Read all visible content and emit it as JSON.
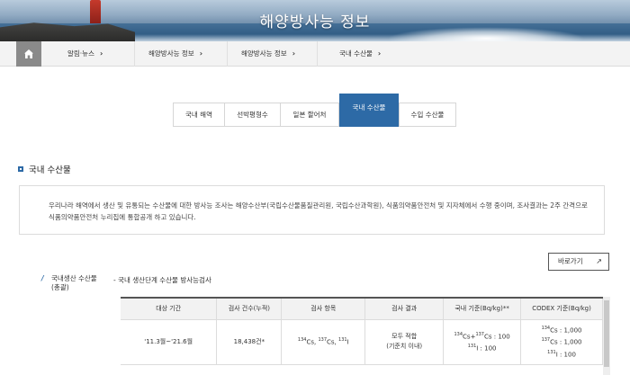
{
  "banner": {
    "title": "해양방사능 정보"
  },
  "breadcrumb": {
    "items": [
      "알림·뉴스",
      "해양방사능 정보",
      "해양방사능 정보",
      "국내 수산물"
    ],
    "chevron": "›"
  },
  "tabs": [
    {
      "label": "국내 해역",
      "active": false
    },
    {
      "label": "선박평형수",
      "active": false
    },
    {
      "label": "일본 할어처",
      "active": false
    },
    {
      "label": "국내 수산물",
      "active": true
    },
    {
      "label": "수입 수산물",
      "active": false
    }
  ],
  "section": {
    "title": "국내 수산물"
  },
  "info": {
    "text": "우리나라 해역에서 생산 및 유통되는 수산물에 대한 방사능 조사는 해양수산부(국립수산물품질관리원, 국립수산과학원), 식품의약품안전처 및 지자체에서 수행 중이며, 조사결과는 2주 간격으로 식품의약품안전처 누리집에 통합공개 하고 있습니다."
  },
  "shortcut": {
    "label": "바로가기",
    "icon": "external-link-icon"
  },
  "category": {
    "label": "국내생산 수산물(총괄)"
  },
  "subsection": {
    "title": "- 국내 생산단계 수산물 방사능검사"
  },
  "table": {
    "headers": [
      "대상 기간",
      "검사 건수(누적)",
      "검사 항목",
      "검사 결과",
      "국내 기준(Bq/kg)**",
      "CODEX 기준(Bq/kg)"
    ],
    "row": {
      "period": "'11.3월~'21.6월",
      "count": "18,438건*",
      "items": {
        "cs134": "134",
        "cs134_text": "Cs, ",
        "cs137": "137",
        "cs137_text": "Cs, ",
        "i131": "131",
        "i131_text": "I"
      },
      "result_line1": "모두 적합",
      "result_line2": "(기준치 이내)",
      "domestic": {
        "a": "134",
        "b": "Cs+",
        "c": "137",
        "d": "Cs : 100",
        "e": "131",
        "f": "I : 100"
      },
      "codex": {
        "a": "134",
        "b": "Cs : 1,000",
        "c": "137",
        "d": "Cs : 1,000",
        "e": "131",
        "f": "I : 100"
      }
    }
  },
  "colors": {
    "accent": "#2d6aa6",
    "home_bg": "#8a8a8a",
    "crumb_bg": "#f3f3f3"
  }
}
